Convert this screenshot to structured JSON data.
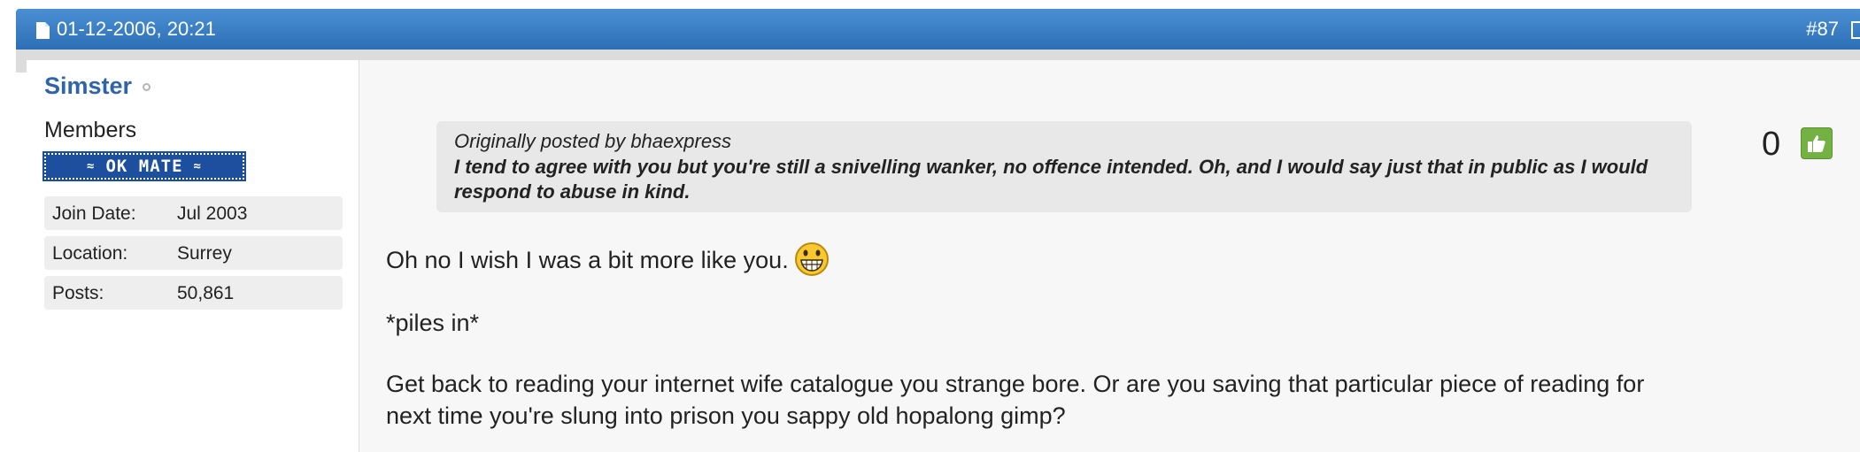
{
  "header": {
    "date": "01-12-2006, 20:21",
    "post_number": "#87",
    "doc_icon": "document-icon",
    "header_color": "#3a7ec6"
  },
  "user": {
    "name": "Simster",
    "status_icon": "offline-status-icon",
    "title": "Members",
    "rank_text": "OK MATE",
    "details": [
      {
        "label": "Join Date:",
        "value": "Jul 2003"
      },
      {
        "label": "Location:",
        "value": "Surrey"
      },
      {
        "label": "Posts:",
        "value": "50,861"
      }
    ]
  },
  "post": {
    "quote": {
      "attribution": "Originally posted by bhaexpress",
      "text": "I tend to agree with you but you're still a snivelling wanker, no offence intended. Oh, and I would say just that in public as I would respond to abuse in kind."
    },
    "like": {
      "count": "0",
      "icon": "thumbs-up-icon",
      "color": "#72b142"
    },
    "paragraphs": [
      "Oh no I wish I was a bit more like you.",
      "*piles in*",
      "Get back to reading your internet wife catalogue you strange bore. Or are you saving that particular piece of reading for next time you're slung into prison you sappy old hopalong gimp?"
    ],
    "smiley_icon": "grinning-smiley-icon"
  }
}
